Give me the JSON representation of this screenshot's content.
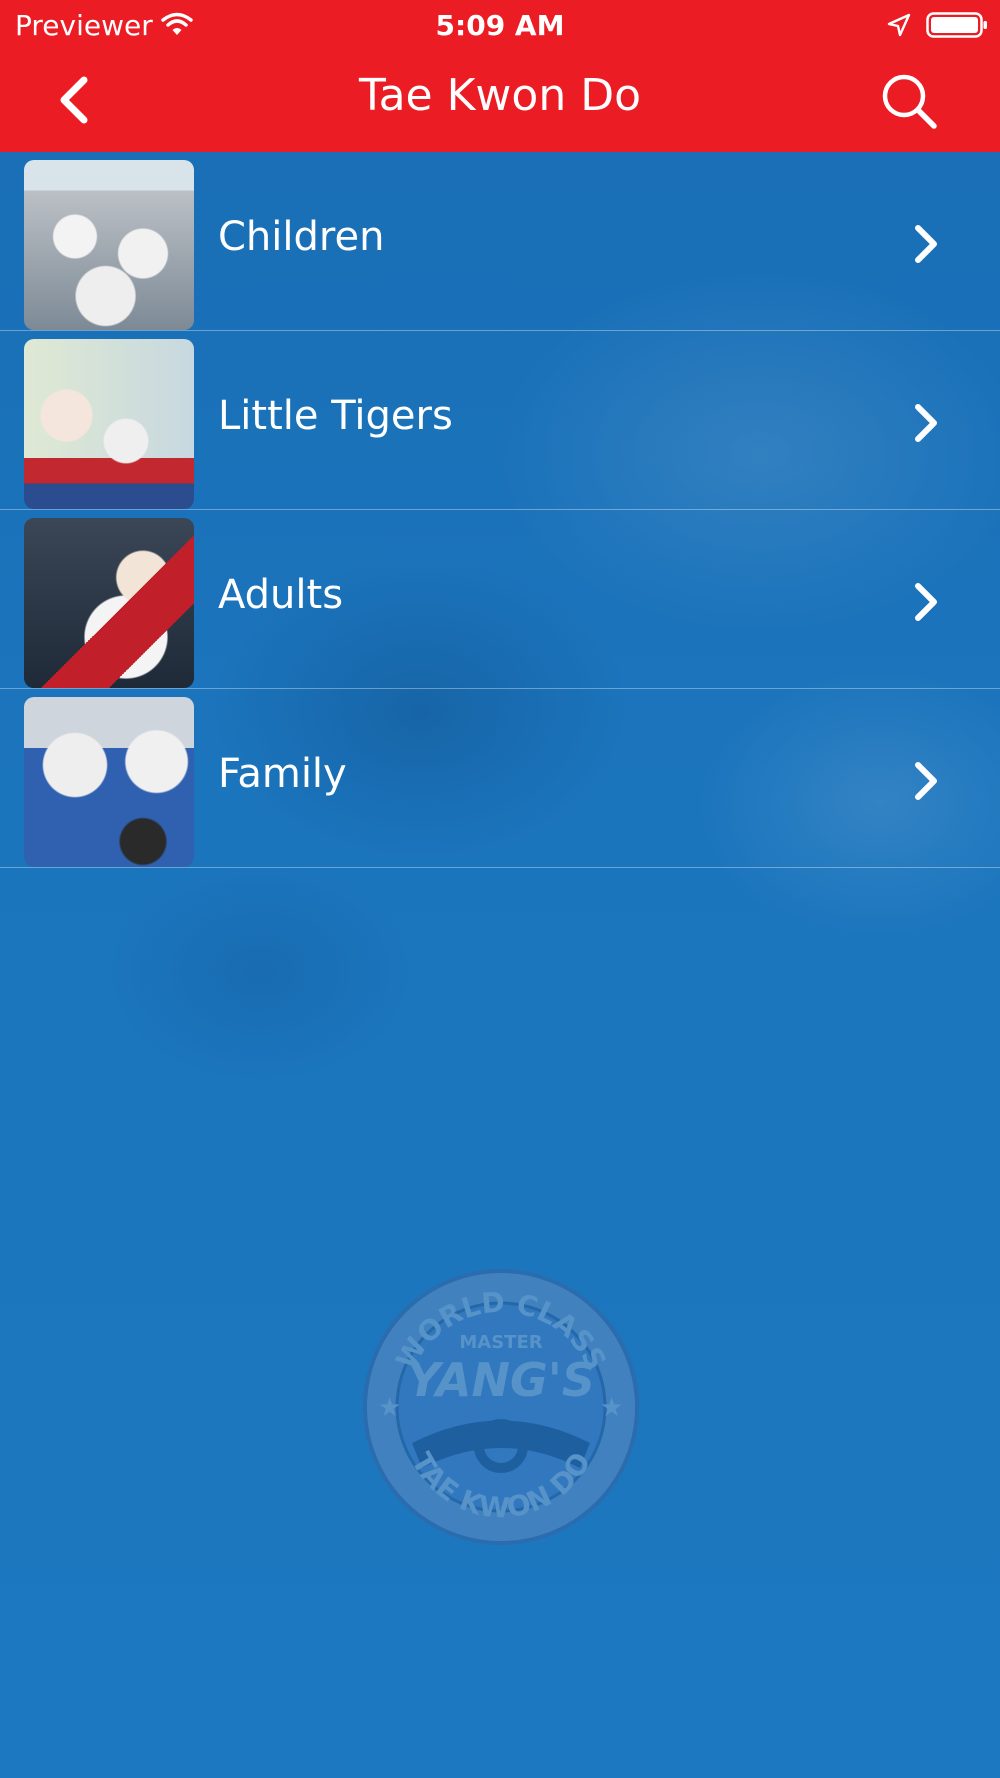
{
  "status_bar": {
    "carrier": "Previewer",
    "time": "5:09 AM"
  },
  "nav": {
    "title": "Tae Kwon Do"
  },
  "list": {
    "items": [
      {
        "label": "Children"
      },
      {
        "label": "Little Tigers"
      },
      {
        "label": "Adults"
      },
      {
        "label": "Family"
      }
    ]
  },
  "logo": {
    "top_text": "WORLD CLASS",
    "master": "MASTER",
    "name": "YANG'S",
    "bottom_text": "TAE KWON DO"
  },
  "colors": {
    "header": "#ec1c24",
    "background": "#1b76bd",
    "text": "#ffffff"
  },
  "icons": [
    "wifi-icon",
    "location-arrow-icon",
    "battery-icon",
    "back-chevron-icon",
    "search-icon",
    "chevron-right-icon"
  ]
}
